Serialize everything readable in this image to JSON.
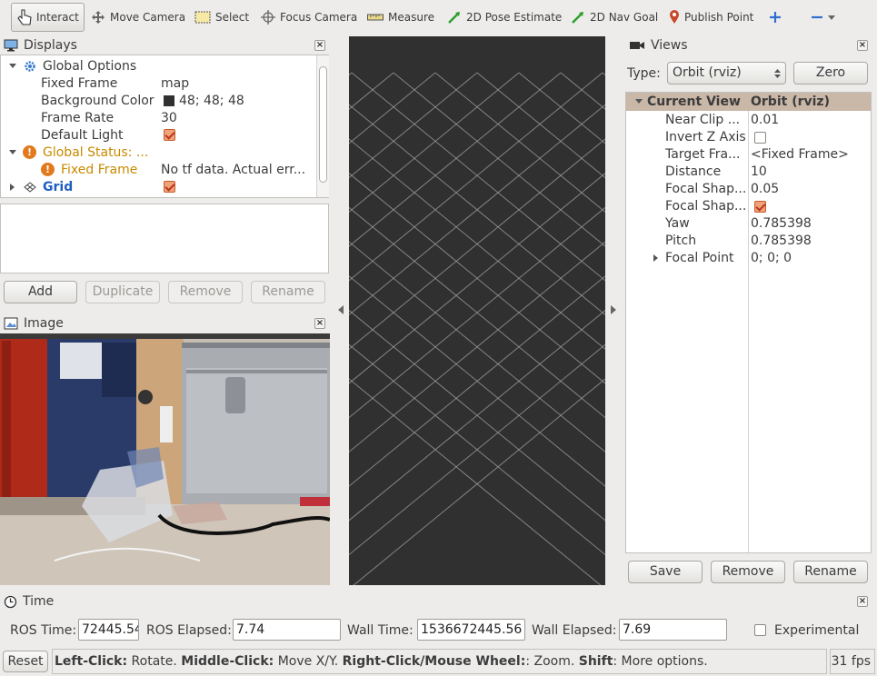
{
  "toolbar": {
    "tools": [
      {
        "name": "interact",
        "label": "Interact"
      },
      {
        "name": "move-camera",
        "label": "Move Camera"
      },
      {
        "name": "select",
        "label": "Select"
      },
      {
        "name": "focus-camera",
        "label": "Focus Camera"
      },
      {
        "name": "measure",
        "label": "Measure"
      },
      {
        "name": "2d-pose-estimate",
        "label": "2D Pose Estimate"
      },
      {
        "name": "2d-nav-goal",
        "label": "2D Nav Goal"
      },
      {
        "name": "publish-point",
        "label": "Publish Point"
      }
    ],
    "active_tool": "interact"
  },
  "displays": {
    "title": "Displays",
    "rows": [
      {
        "label": "Global Options",
        "value": ""
      },
      {
        "label": "Fixed Frame",
        "value": "map"
      },
      {
        "label": "Background Color",
        "value": "48; 48; 48",
        "color": "#303030"
      },
      {
        "label": "Frame Rate",
        "value": "30"
      },
      {
        "label": "Default Light",
        "checked": true
      },
      {
        "label": "Global Status: ...",
        "status": "warning"
      },
      {
        "label": "Fixed Frame",
        "value": "No tf data.  Actual err...",
        "status": "warning"
      },
      {
        "label": "Grid",
        "checked": true
      }
    ],
    "buttons": {
      "add": "Add",
      "duplicate": "Duplicate",
      "remove": "Remove",
      "rename": "Rename"
    }
  },
  "image_panel": {
    "title": "Image"
  },
  "views": {
    "title": "Views",
    "type_label": "Type:",
    "type_value": "Orbit (rviz)",
    "zero_label": "Zero",
    "header": {
      "name": "Current View",
      "value": "Orbit (rviz)"
    },
    "rows": [
      {
        "label": "Near Clip ...",
        "value": "0.01"
      },
      {
        "label": "Invert Z Axis",
        "checked": false
      },
      {
        "label": "Target Fra...",
        "value": "<Fixed Frame>"
      },
      {
        "label": "Distance",
        "value": "10"
      },
      {
        "label": "Focal Shap...",
        "value": "0.05"
      },
      {
        "label": "Focal Shap...",
        "checked": true
      },
      {
        "label": "Yaw",
        "value": "0.785398"
      },
      {
        "label": "Pitch",
        "value": "0.785398"
      },
      {
        "label": "Focal Point",
        "value": "0; 0; 0"
      }
    ],
    "buttons": {
      "save": "Save",
      "remove": "Remove",
      "rename": "Rename"
    }
  },
  "time": {
    "title": "Time",
    "ros_time_label": "ROS Time:",
    "ros_time": "72445.54",
    "ros_elapsed_label": "ROS Elapsed:",
    "ros_elapsed": "7.74",
    "wall_time_label": "Wall Time:",
    "wall_time": "1536672445.56",
    "wall_elapsed_label": "Wall Elapsed:",
    "wall_elapsed": "7.69",
    "experimental_label": "Experimental"
  },
  "status_bar": {
    "reset_label": "Reset",
    "hint_1b": "Left-Click:",
    "hint_1": " Rotate. ",
    "hint_2b": "Middle-Click:",
    "hint_2": " Move X/Y. ",
    "hint_3b": "Right-Click/Mouse Wheel:",
    "hint_3": ": Zoom. ",
    "hint_4b": "Shift",
    "hint_4": ": More options.",
    "fps": "31 fps"
  },
  "colors": {
    "viewport_bg": "#303030",
    "grid": "#a0a0a0",
    "warning": "#c88a00",
    "grid_label": "#1f5fbf",
    "header_bg": "#c9b7a7"
  }
}
